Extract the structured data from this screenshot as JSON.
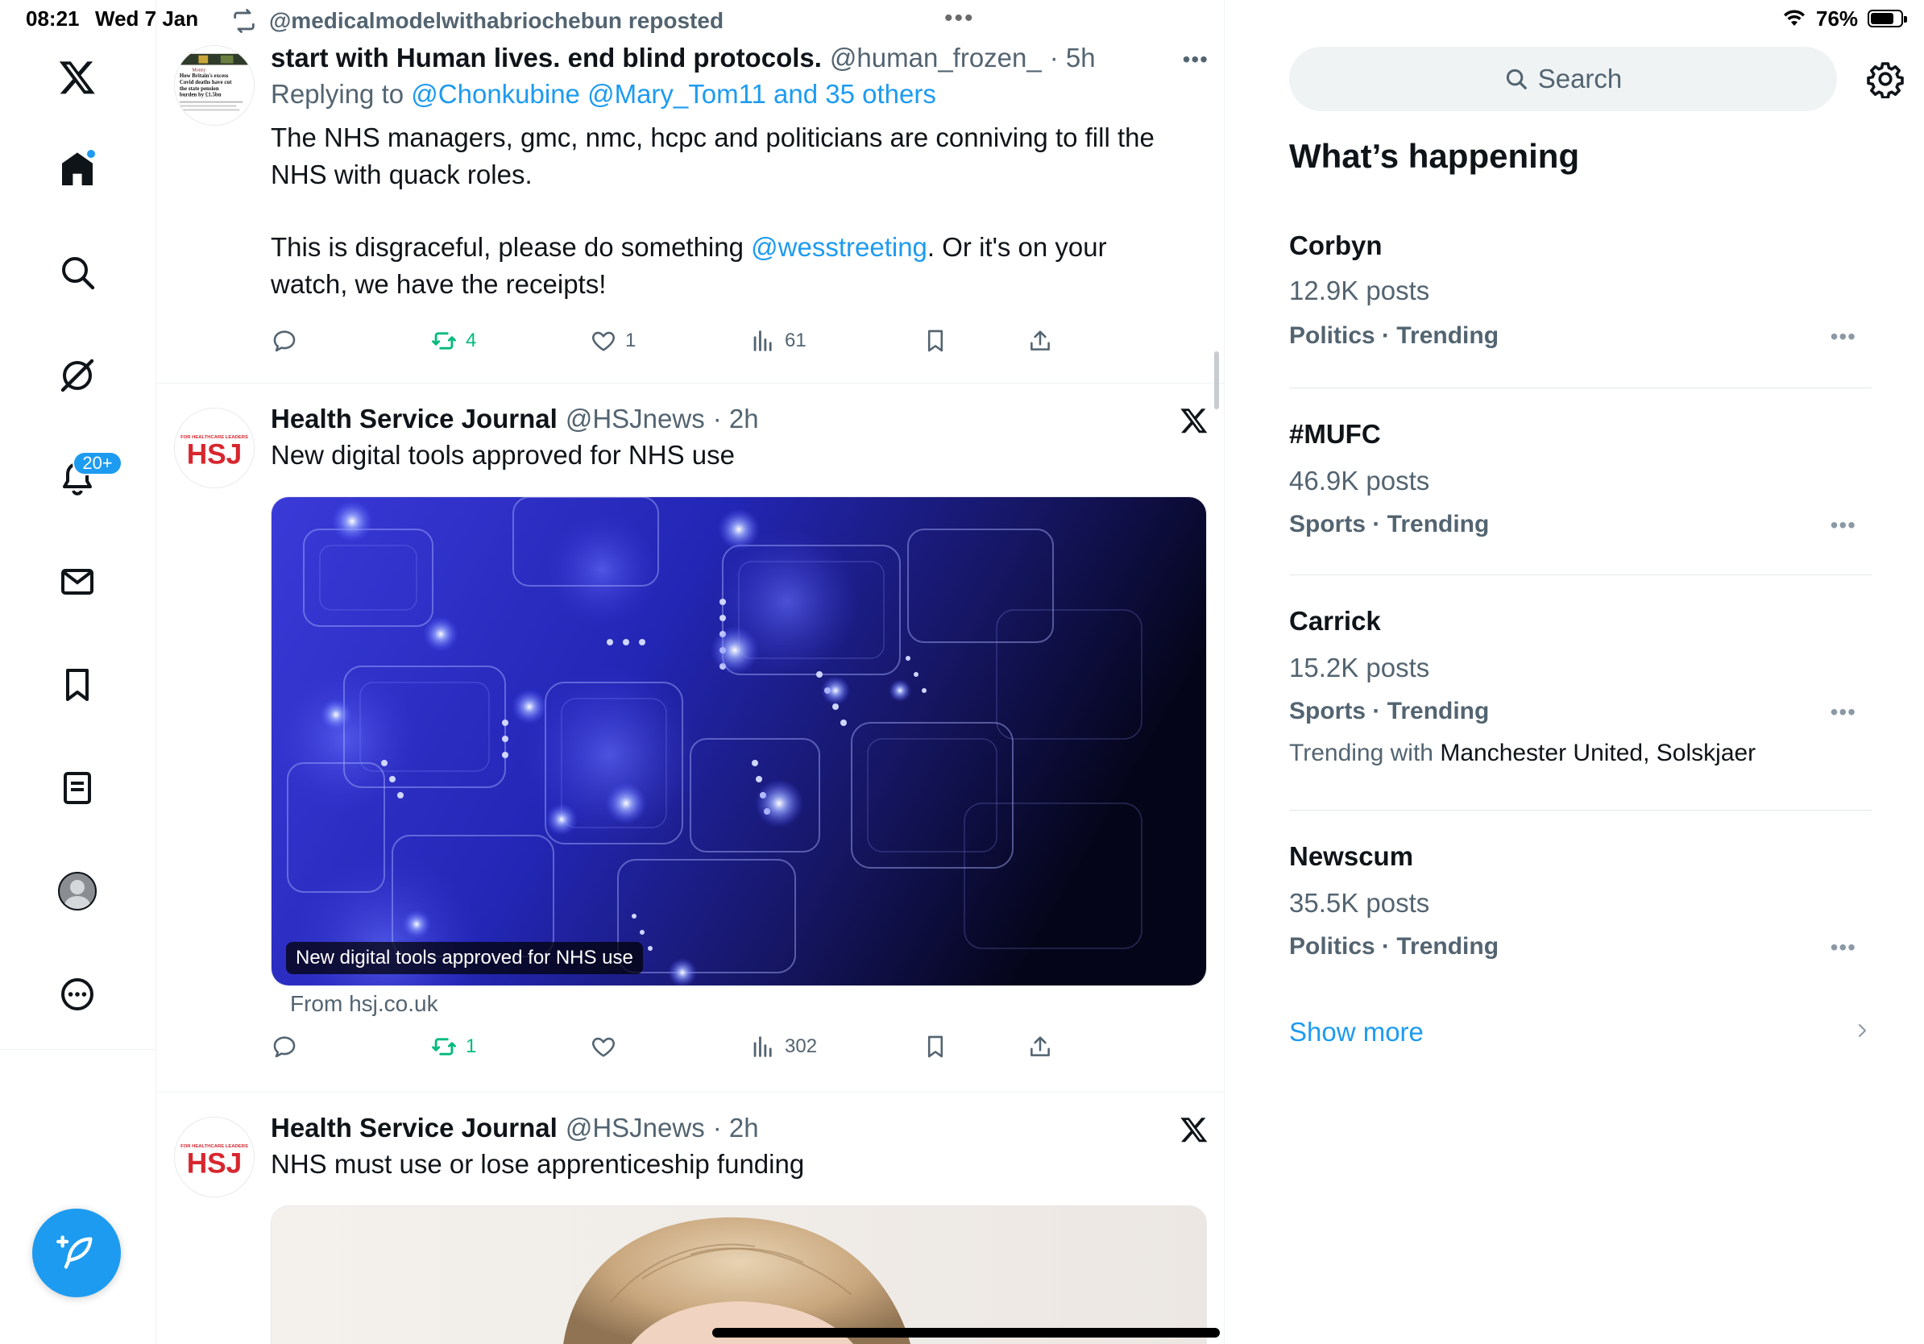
{
  "status_bar": {
    "time": "08:21",
    "date": "Wed 7 Jan",
    "battery_percent": "76%"
  },
  "nav": {
    "items": [
      "x-logo",
      "home",
      "explore",
      "grok",
      "notifications",
      "messages",
      "bookmarks",
      "lists",
      "profile",
      "more"
    ],
    "notifications_badge": "20+"
  },
  "timeline": {
    "repost_label": "@medicalmodelwithabriochebun reposted",
    "tweets": [
      {
        "name": "start with Human lives. end blind protocols.",
        "handle": "@human_frozen_",
        "time": "· 5h",
        "reply_prefix": "Replying to",
        "reply_targets": "@Chonkubine @Mary_Tom11 and 35 others",
        "text_line1": "The NHS managers, gmc, nmc, hcpc and politicians are conniving to fill the NHS with quack roles.",
        "text_line2_a": "This is disgraceful, please do something",
        "text_line2_mention": "@wesstreeting",
        "text_line2_b": ". Or it's on your watch, we have the receipts!",
        "reposts": "4",
        "likes": "1",
        "views": "61",
        "avatar_caption": "How Britain's excess Covid deaths have cut the state pension burden by £1.5bn"
      },
      {
        "name": "Health Service Journal",
        "handle": "@HSJnews",
        "time": "· 2h",
        "text": "New digital tools approved for NHS use",
        "card_caption": "New digital tools approved for NHS use",
        "card_from": "From hsj.co.uk",
        "reposts": "1",
        "likes": "",
        "views": "302",
        "avatar_tag": "FOR HEALTHCARE LEADERS",
        "avatar_logo": "HSJ"
      },
      {
        "name": "Health Service Journal",
        "handle": "@HSJnews",
        "time": "· 2h",
        "text": "NHS must use or lose apprenticeship funding",
        "avatar_tag": "FOR HEALTHCARE LEADERS",
        "avatar_logo": "HSJ"
      }
    ]
  },
  "sidebar": {
    "search_placeholder": "Search",
    "section_title": "What’s happening",
    "trends": [
      {
        "name": "Corbyn",
        "posts": "12.9K posts",
        "category": "Politics · Trending"
      },
      {
        "name": "#MUFC",
        "posts": "46.9K posts",
        "category": "Sports · Trending"
      },
      {
        "name": "Carrick",
        "posts": "15.2K posts",
        "category": "Sports · Trending",
        "with_prefix": "Trending with",
        "with_names": "Manchester United, Solskjaer"
      },
      {
        "name": "Newscum",
        "posts": "35.5K posts",
        "category": "Politics · Trending"
      }
    ],
    "show_more": "Show more"
  },
  "colors": {
    "accent": "#1d9bf0",
    "repost_green": "#00ba7c",
    "secondary_text": "#536471",
    "hsj_red": "#d7262e"
  }
}
